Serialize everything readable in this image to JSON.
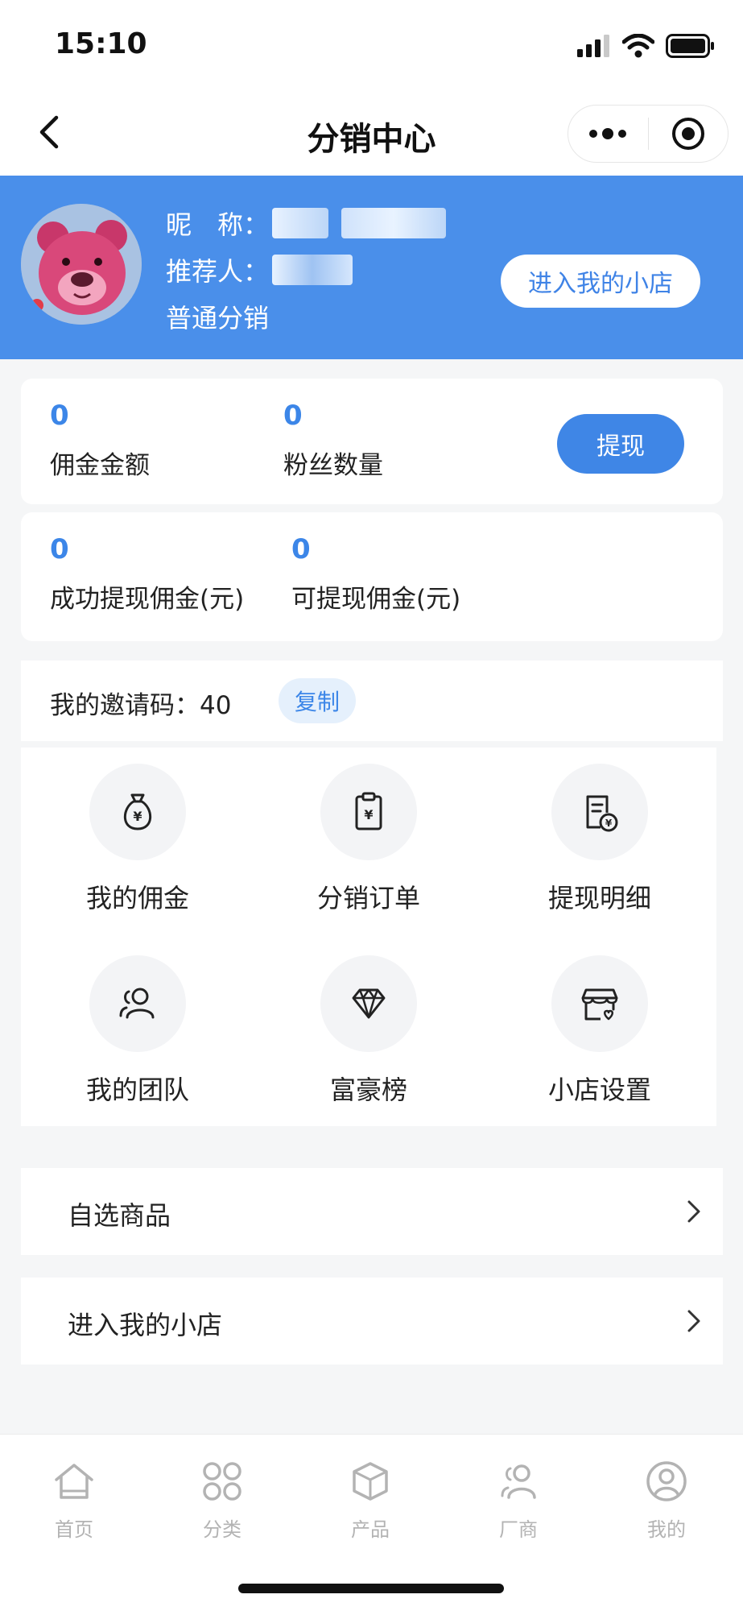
{
  "status_bar": {
    "time": "15:10"
  },
  "nav": {
    "title": "分销中心"
  },
  "profile": {
    "nickname_label": "昵　称：",
    "referrer_label": "推荐人：",
    "level": "普通分销",
    "shop_button": "进入我的小店"
  },
  "stats": [
    {
      "value": "0",
      "label": "佣金金额"
    },
    {
      "value": "0",
      "label": "粉丝数量"
    },
    {
      "value": "0",
      "label": "成功提现佣金(元)"
    },
    {
      "value": "0",
      "label": "可提现佣金(元)"
    }
  ],
  "withdraw_button": "提现",
  "invite": {
    "label": "我的邀请码：",
    "code": "40",
    "copy_label": "复制"
  },
  "grid": [
    {
      "label": "我的佣金",
      "icon": "money-bag-icon"
    },
    {
      "label": "分销订单",
      "icon": "order-clipboard-icon"
    },
    {
      "label": "提现明细",
      "icon": "withdraw-detail-icon"
    },
    {
      "label": "我的团队",
      "icon": "team-icon"
    },
    {
      "label": "富豪榜",
      "icon": "diamond-icon"
    },
    {
      "label": "小店设置",
      "icon": "shop-settings-icon"
    }
  ],
  "list": [
    {
      "label": "自选商品"
    },
    {
      "label": "进入我的小店"
    }
  ],
  "tabs": [
    {
      "label": "首页",
      "icon": "home-icon"
    },
    {
      "label": "分类",
      "icon": "category-icon"
    },
    {
      "label": "产品",
      "icon": "product-box-icon"
    },
    {
      "label": "厂商",
      "icon": "manufacturer-icon"
    },
    {
      "label": "我的",
      "icon": "profile-icon"
    }
  ],
  "colors": {
    "brand": "#4a8fea",
    "accent": "#3c86e8",
    "tab_inactive": "#b3b3b3"
  }
}
